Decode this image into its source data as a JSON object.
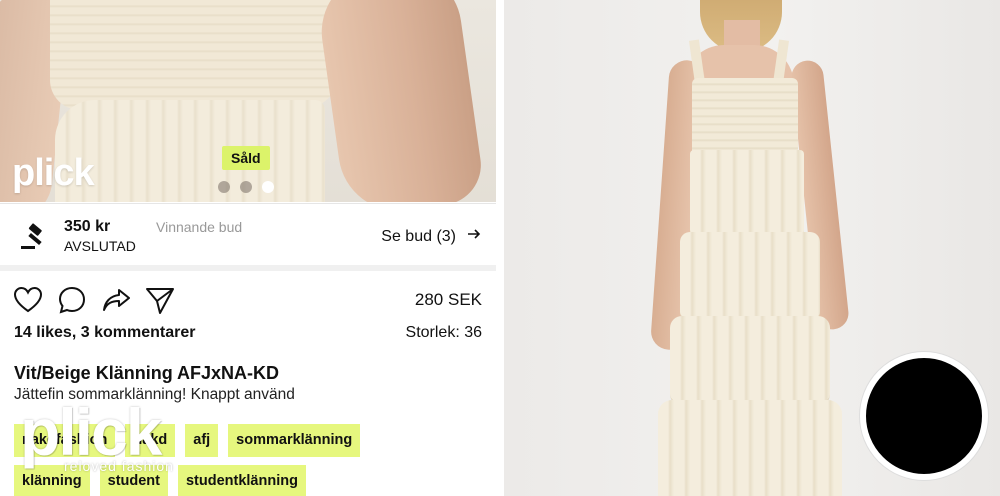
{
  "left_panel": {
    "carousel": {
      "logo_text": "plick",
      "sold_badge": "Såld",
      "dots": 3,
      "active_dot": 3
    },
    "auction": {
      "icon": "gavel-icon",
      "price": "350 kr",
      "price_note": "Vinnande bud",
      "status": "AVSLUTAD",
      "see_bids": "Se bud (3)",
      "see_bids_icon": "arrow-right-icon"
    },
    "actions": {
      "like_icon": "heart-icon",
      "comment_icon": "comment-icon",
      "share_icon": "share-arrow-icon",
      "send_icon": "send-icon"
    },
    "price": "280 SEK",
    "likes_comments": "14 likes, 3 kommentarer",
    "size": "Storlek: 36",
    "title": "Vit/Beige Klänning AFJxNA-KD",
    "description": "Jättefin sommarklänning! Knappt använd",
    "tags": [
      [
        "nakdfashion",
        "nakd",
        "afj",
        "sommarklänning"
      ],
      [
        "klänning",
        "student",
        "studentklänning"
      ]
    ],
    "watermark": {
      "logo": "plick",
      "tagline": "reloved fashion"
    }
  },
  "colors": {
    "tag_bg": "#e6f77e",
    "badge_bg": "#dcf36a",
    "text": "#111111"
  }
}
